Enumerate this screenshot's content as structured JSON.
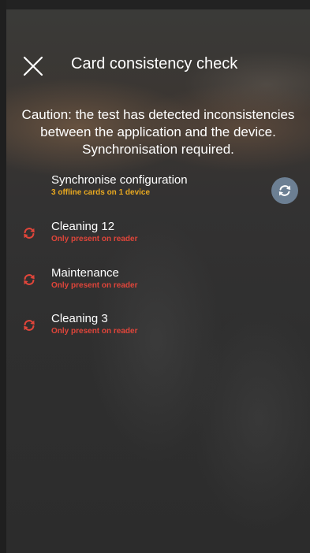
{
  "header": {
    "title": "Card consistency check",
    "close_icon": "close-icon"
  },
  "caution": [
    "Caution: the test has detected inconsistencies",
    "between the application and the device.",
    "Synchronisation required."
  ],
  "sync": {
    "label": "Synchronise configuration",
    "detail": "3 offline cards on 1 device",
    "icon": "sync-icon"
  },
  "cards": [
    {
      "name": "Cleaning 12",
      "status": "Only present on reader",
      "icon": "sync-error-icon"
    },
    {
      "name": "Maintenance",
      "status": "Only present on reader",
      "icon": "sync-error-icon"
    },
    {
      "name": "Cleaning 3",
      "status": "Only present on reader",
      "icon": "sync-error-icon"
    }
  ],
  "colors": {
    "warning": "#e8a820",
    "error": "#e0453a",
    "sync_button": "#6c7f93"
  }
}
